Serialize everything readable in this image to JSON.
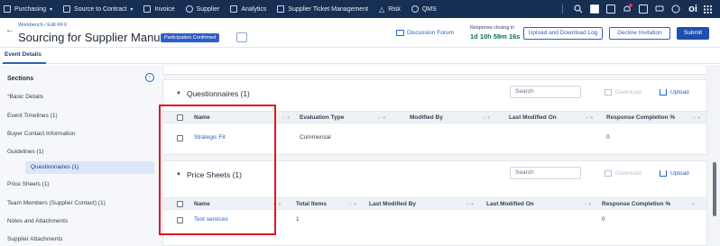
{
  "topnav": {
    "items": [
      {
        "label": "Purchasing",
        "icon": "cart-icon",
        "chevron": "▾"
      },
      {
        "label": "Source to Contract",
        "icon": "doc-icon",
        "chevron": "▾"
      },
      {
        "label": "Invoice",
        "icon": "invoice-icon"
      },
      {
        "label": "Supplier",
        "icon": "supplier-icon"
      },
      {
        "label": "Analytics",
        "icon": "chart-icon"
      },
      {
        "label": "Supplier Ticket Management",
        "icon": "ticket-icon"
      },
      {
        "label": "Risk",
        "icon": "warning-icon"
      },
      {
        "label": "QMS",
        "icon": "qms-icon"
      }
    ],
    "brand": "oi"
  },
  "header": {
    "breadcrumb": "Workbench / Edit RFX",
    "title": "Sourcing for Supplier Manual",
    "status_badge": "Participation Confirmed",
    "discussion_forum": "Discussion Forum",
    "closing_label": "Response closing in",
    "closing_time": "1d 10h 59m 16s",
    "upload_download_log": "Upload and Download Log",
    "decline_invitation": "Decline Invitation",
    "submit": "Submit"
  },
  "tabs": {
    "event_details": "Event Details"
  },
  "sidebar": {
    "title": "Sections",
    "items": [
      {
        "label": "Basic Details",
        "required": "*"
      },
      {
        "label": "Event Timelines (1)"
      },
      {
        "label": "Buyer Contact Information"
      },
      {
        "label": "Guidelines (1)"
      },
      {
        "label": "Questionnaires (1)"
      },
      {
        "label": "Price Sheets (1)"
      },
      {
        "label": "Team Members (Supplier Contact) (1)"
      },
      {
        "label": "Notes and Attachments"
      },
      {
        "label": "Supplier Attachments"
      }
    ]
  },
  "questionnaires": {
    "title": "Questionnaires (1)",
    "search_placeholder": "Search",
    "download": "Download",
    "upload": "Upload",
    "columns": [
      "Name",
      "Evaluation Type",
      "Modified By",
      "Last Modified On",
      "Response Completion %"
    ],
    "rows": [
      {
        "name": "Strategic Fit",
        "evaluation_type": "Commercial",
        "modified_by": "",
        "last_modified_on": "",
        "completion": "0"
      }
    ]
  },
  "price_sheets": {
    "title": "Price Sheets (1)",
    "search_placeholder": "Search",
    "download": "Download",
    "upload": "Upload",
    "columns": [
      "Name",
      "Total Items",
      "Last Modified By",
      "Last Modified On",
      "Response Completion %"
    ],
    "rows": [
      {
        "name": "Test services",
        "total_items": "1",
        "last_modified_by": "",
        "last_modified_on": "",
        "completion": "0"
      }
    ]
  },
  "colors": {
    "nav_bg": "#172f52",
    "accent": "#2f5fc4",
    "link": "#2563c7",
    "annotation": "#e0161e",
    "countdown": "#166f4a"
  }
}
